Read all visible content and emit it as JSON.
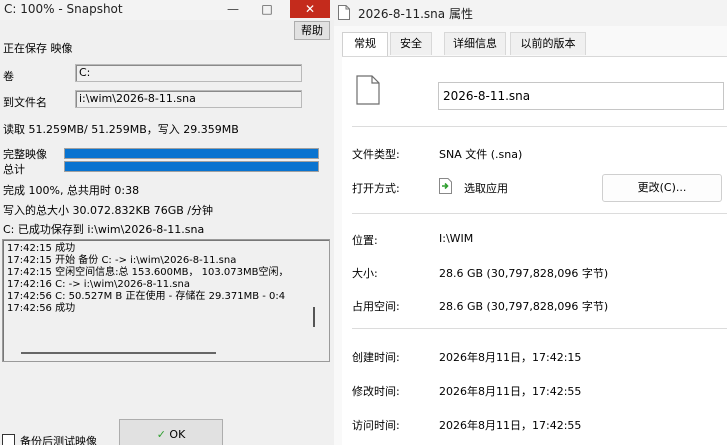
{
  "snapshot": {
    "title": "C: 100% - Snapshot",
    "help_label": "帮助",
    "status_heading": "正在保存 映像",
    "volume_label": "卷",
    "volume_value": "C:",
    "file_label": "到文件名",
    "file_value": "i:\\wim\\2026-8-11.sna",
    "rw_line": "读取   51.259MB/   51.259MB，写入    29.359MB",
    "full_image_label": "完整映像",
    "full_image_progress": 1.0,
    "total_label": "总计",
    "total_progress": 1.0,
    "done_line": "完成 100%, 总共用时  0:38",
    "written_line": "写入的总大小 30.072.832KB     76GB /分钟",
    "saved_line": "C: 已成功保存到 i:\\wim\\2026-8-11.sna",
    "log_lines": [
      "17:42:15 成功",
      "17:42:15 开始  备份 C: -> i:\\wim\\2026-8-11.sna",
      "17:42:15 空闲空间信息:总 153.600MB，   103.073MB空闲，",
      "17:42:16 C: -> i:\\wim\\2026-8-11.sna",
      "17:42:56 C:    50.527M B 正在使用 - 存储在    29.371MB - 0:4",
      "17:42:56 成功"
    ],
    "verify_label": "备份后测试映像",
    "ok_label": "OK"
  },
  "props": {
    "title": "2026-8-11.sna 属性",
    "tabs": [
      {
        "label": "常规"
      },
      {
        "label": "安全"
      },
      {
        "label": "详细信息"
      },
      {
        "label": "以前的版本"
      }
    ],
    "file_name": "2026-8-11.sna",
    "type_label": "文件类型:",
    "type_value": "SNA 文件 (.sna)",
    "open_label": "打开方式:",
    "open_value": "选取应用",
    "change_button": "更改(C)...",
    "location_label": "位置:",
    "location_value": "I:\\WIM",
    "size_label": "大小:",
    "size_value": "28.6 GB (30,797,828,096 字节)",
    "disk_label": "占用空间:",
    "disk_value": "28.6 GB (30,797,828,096 字节)",
    "created_label": "创建时间:",
    "created_value": "2026年8月11日，17:42:15",
    "modified_label": "修改时间:",
    "modified_value": "2026年8月11日，17:42:55",
    "accessed_label": "访问时间:",
    "accessed_value": "2026年8月11日，17:42:55"
  },
  "colors": {
    "progress": "#0873d0",
    "close_red": "#c42b1c",
    "ok_check": "#2e9e2e"
  }
}
